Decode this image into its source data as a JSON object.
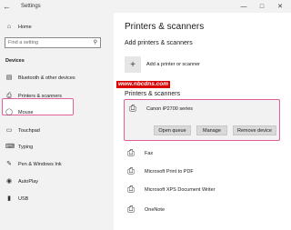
{
  "window": {
    "back_icon": "back-arrow-icon",
    "title": "Settings",
    "controls": [
      "minimize-icon",
      "maximize-icon",
      "close-icon"
    ]
  },
  "sidebar": {
    "home_label": "Home",
    "search_placeholder": "Find a setting",
    "section_label": "Devices",
    "items": [
      {
        "label": "Bluetooth & other devices",
        "icon": "bluetooth-icon"
      },
      {
        "label": "Printers & scanners",
        "icon": "printer-icon",
        "selected": true
      },
      {
        "label": "Mouse",
        "icon": "mouse-icon"
      },
      {
        "label": "Touchpad",
        "icon": "touchpad-icon"
      },
      {
        "label": "Typing",
        "icon": "keyboard-icon"
      },
      {
        "label": "Pen & Windows Ink",
        "icon": "pen-icon"
      },
      {
        "label": "AutoPlay",
        "icon": "autoplay-icon"
      },
      {
        "label": "USB",
        "icon": "usb-icon"
      }
    ]
  },
  "main": {
    "title": "Printers & scanners",
    "add_heading": "Add printers & scanners",
    "add_label": "Add a printer or scanner",
    "list_heading": "Printers & scanners",
    "selected_printer": {
      "name": "Canon iP2700 series",
      "buttons": [
        "Open queue",
        "Manage",
        "Remove device"
      ]
    },
    "printers": [
      "Fax",
      "Microsoft Print to PDF",
      "Microsoft XPS Document Writer",
      "OneNote"
    ]
  },
  "watermark": "www.nbcdns.com",
  "colors": {
    "highlight": "#e0609a",
    "sidebar_bg": "#f2f2f2",
    "watermark_bg": "#d80000"
  }
}
